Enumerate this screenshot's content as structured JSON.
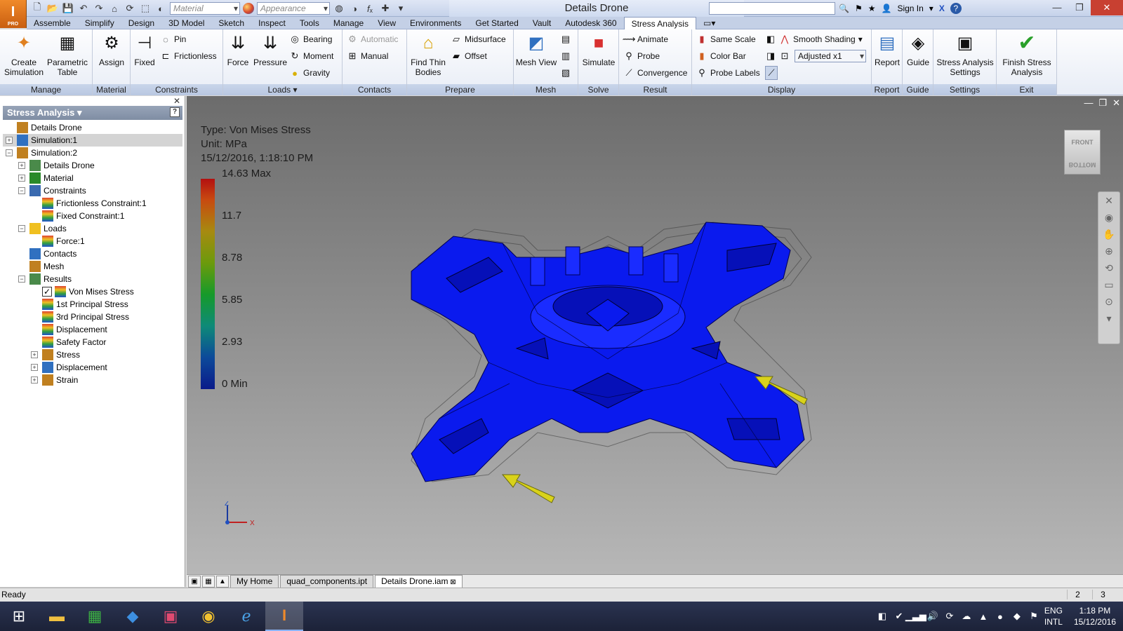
{
  "app": {
    "logo": "I",
    "edition": "PRO",
    "doc_title": "Details Drone"
  },
  "qat": {
    "material": "Material",
    "appearance": "Appearance",
    "sign_in": "Sign In"
  },
  "menus": [
    "Assemble",
    "Simplify",
    "Design",
    "3D Model",
    "Sketch",
    "Inspect",
    "Tools",
    "Manage",
    "View",
    "Environments",
    "Get Started",
    "Vault",
    "Autodesk 360",
    "Stress Analysis"
  ],
  "active_menu": "Stress Analysis",
  "ribbon": {
    "manage": {
      "title": "Manage",
      "create": "Create Simulation",
      "param": "Parametric Table"
    },
    "material": {
      "title": "Material",
      "assign": "Assign"
    },
    "constraints": {
      "title": "Constraints",
      "fixed": "Fixed",
      "pin": "Pin",
      "frictionless": "Frictionless"
    },
    "loads": {
      "title": "Loads",
      "force": "Force",
      "pressure": "Pressure",
      "bearing": "Bearing",
      "moment": "Moment",
      "gravity": "Gravity"
    },
    "contacts": {
      "title": "Contacts",
      "automatic": "Automatic",
      "manual": "Manual"
    },
    "prepare": {
      "title": "Prepare",
      "find": "Find Thin Bodies",
      "midsurface": "Midsurface",
      "offset": "Offset"
    },
    "mesh": {
      "title": "Mesh",
      "view": "Mesh View"
    },
    "solve": {
      "title": "Solve",
      "simulate": "Simulate"
    },
    "result": {
      "title": "Result",
      "animate": "Animate",
      "probe": "Probe",
      "convergence": "Convergence"
    },
    "display": {
      "title": "Display",
      "same_scale": "Same Scale",
      "color_bar": "Color Bar",
      "probe_labels": "Probe Labels",
      "shading": "Smooth Shading",
      "adjusted": "Adjusted x1"
    },
    "report": {
      "title": "Report",
      "report": "Report"
    },
    "guide": {
      "title": "Guide",
      "guide": "Guide"
    },
    "settings": {
      "title": "Settings",
      "settings": "Stress Analysis Settings"
    },
    "exit": {
      "title": "Exit",
      "finish": "Finish Stress Analysis"
    }
  },
  "browser": {
    "title": "Stress Analysis",
    "tree": [
      {
        "label": "Details Drone",
        "depth": 0,
        "expander": ""
      },
      {
        "label": "Simulation:1",
        "depth": 0,
        "expander": "+",
        "selected": true
      },
      {
        "label": "Simulation:2",
        "depth": 0,
        "expander": "−"
      },
      {
        "label": "Details Drone",
        "depth": 1,
        "expander": "+"
      },
      {
        "label": "Material",
        "depth": 1,
        "expander": "+"
      },
      {
        "label": "Constraints",
        "depth": 1,
        "expander": "−"
      },
      {
        "label": "Frictionless Constraint:1",
        "depth": 2,
        "expander": ""
      },
      {
        "label": "Fixed Constraint:1",
        "depth": 2,
        "expander": ""
      },
      {
        "label": "Loads",
        "depth": 1,
        "expander": "−"
      },
      {
        "label": "Force:1",
        "depth": 2,
        "expander": ""
      },
      {
        "label": "Contacts",
        "depth": 1,
        "expander": ""
      },
      {
        "label": "Mesh",
        "depth": 1,
        "expander": ""
      },
      {
        "label": "Results",
        "depth": 1,
        "expander": "−"
      },
      {
        "label": "Von Mises Stress",
        "depth": 2,
        "expander": "",
        "checked": true
      },
      {
        "label": "1st Principal Stress",
        "depth": 2,
        "expander": ""
      },
      {
        "label": "3rd Principal Stress",
        "depth": 2,
        "expander": ""
      },
      {
        "label": "Displacement",
        "depth": 2,
        "expander": ""
      },
      {
        "label": "Safety Factor",
        "depth": 2,
        "expander": ""
      },
      {
        "label": "Stress",
        "depth": 2,
        "expander": "+"
      },
      {
        "label": "Displacement",
        "depth": 2,
        "expander": "+"
      },
      {
        "label": "Strain",
        "depth": 2,
        "expander": "+"
      }
    ]
  },
  "legend": {
    "type": "Type: Von Mises Stress",
    "unit": "Unit: MPa",
    "date": "15/12/2016, 1:18:10 PM",
    "labels": [
      "14.63 Max",
      "11.7",
      "8.78",
      "5.85",
      "2.93",
      "0 Min"
    ]
  },
  "viewcube": {
    "top": "FRONT",
    "bottom": "BOTTOM"
  },
  "axes": {
    "z": "Z",
    "x": "X"
  },
  "tabs": [
    "My Home",
    "quad_components.ipt",
    "Details Drone.iam"
  ],
  "active_tab": "Details Drone.iam",
  "status": {
    "text": "Ready",
    "n1": "2",
    "n2": "3"
  },
  "tray": {
    "lang1": "ENG",
    "lang2": "INTL",
    "time": "1:18 PM",
    "date": "15/12/2016"
  },
  "colors": {
    "model": "#0a1aee",
    "arrow": "#d9d21a",
    "ribbon_active": "#ffffff"
  }
}
